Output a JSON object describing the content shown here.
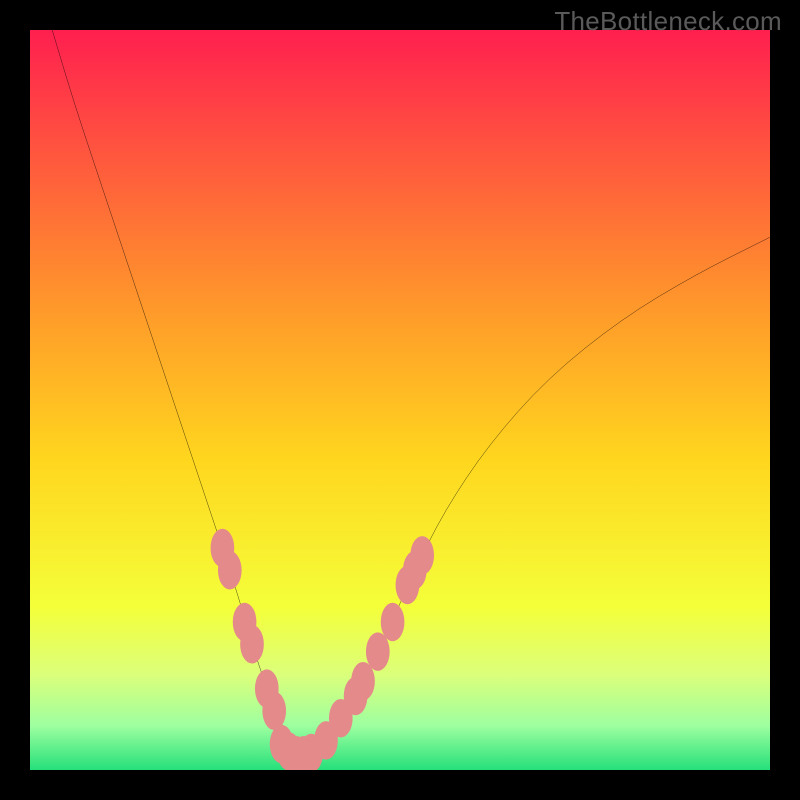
{
  "watermark": "TheBottleneck.com",
  "chart_data": {
    "type": "line",
    "title": "",
    "xlabel": "",
    "ylabel": "",
    "xlim": [
      0,
      100
    ],
    "ylim": [
      0,
      100
    ],
    "grid": false,
    "legend": false,
    "bg_gradient": [
      {
        "offset": 0,
        "color": "#ff1f4f"
      },
      {
        "offset": 0.18,
        "color": "#ff5a3d"
      },
      {
        "offset": 0.38,
        "color": "#ff9a2a"
      },
      {
        "offset": 0.58,
        "color": "#ffd61e"
      },
      {
        "offset": 0.78,
        "color": "#f4ff3a"
      },
      {
        "offset": 0.87,
        "color": "#dcff7a"
      },
      {
        "offset": 0.94,
        "color": "#9effa0"
      },
      {
        "offset": 1.0,
        "color": "#25e07a"
      }
    ],
    "series": [
      {
        "name": "bottleneck-curve",
        "color": "#000000",
        "x": [
          3,
          6,
          10,
          14,
          18,
          22,
          25,
          28,
          30,
          32,
          34,
          36,
          38,
          40,
          44,
          48,
          52,
          56,
          62,
          70,
          80,
          90,
          100
        ],
        "y": [
          100,
          90,
          78,
          66,
          54,
          42,
          33,
          24,
          17,
          11,
          6,
          3,
          2,
          3,
          9,
          18,
          27,
          35,
          44,
          53,
          61,
          67,
          72
        ]
      }
    ],
    "markers": {
      "name": "highlighted-points",
      "color": "#e58a8a",
      "rx": 1.6,
      "ry": 2.6,
      "points": [
        {
          "x": 26,
          "y": 30
        },
        {
          "x": 27,
          "y": 27
        },
        {
          "x": 29,
          "y": 20
        },
        {
          "x": 30,
          "y": 17
        },
        {
          "x": 32,
          "y": 11
        },
        {
          "x": 33,
          "y": 8
        },
        {
          "x": 34,
          "y": 3.5
        },
        {
          "x": 35,
          "y": 2.5
        },
        {
          "x": 36,
          "y": 2
        },
        {
          "x": 37,
          "y": 2
        },
        {
          "x": 38,
          "y": 2.3
        },
        {
          "x": 40,
          "y": 4
        },
        {
          "x": 42,
          "y": 7
        },
        {
          "x": 44,
          "y": 10
        },
        {
          "x": 45,
          "y": 12
        },
        {
          "x": 47,
          "y": 16
        },
        {
          "x": 49,
          "y": 20
        },
        {
          "x": 51,
          "y": 25
        },
        {
          "x": 52,
          "y": 27
        },
        {
          "x": 53,
          "y": 29
        }
      ]
    }
  }
}
